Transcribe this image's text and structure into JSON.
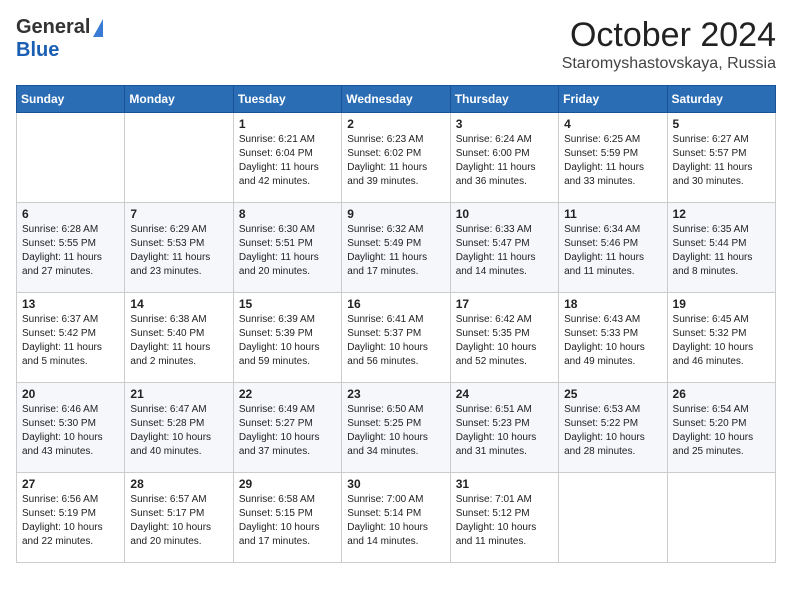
{
  "header": {
    "logo_line1": "General",
    "logo_line2": "Blue",
    "month": "October 2024",
    "location": "Staromyshastovskaya, Russia"
  },
  "days_of_week": [
    "Sunday",
    "Monday",
    "Tuesday",
    "Wednesday",
    "Thursday",
    "Friday",
    "Saturday"
  ],
  "weeks": [
    [
      {
        "day": "",
        "content": ""
      },
      {
        "day": "",
        "content": ""
      },
      {
        "day": "1",
        "content": "Sunrise: 6:21 AM\nSunset: 6:04 PM\nDaylight: 11 hours and 42 minutes."
      },
      {
        "day": "2",
        "content": "Sunrise: 6:23 AM\nSunset: 6:02 PM\nDaylight: 11 hours and 39 minutes."
      },
      {
        "day": "3",
        "content": "Sunrise: 6:24 AM\nSunset: 6:00 PM\nDaylight: 11 hours and 36 minutes."
      },
      {
        "day": "4",
        "content": "Sunrise: 6:25 AM\nSunset: 5:59 PM\nDaylight: 11 hours and 33 minutes."
      },
      {
        "day": "5",
        "content": "Sunrise: 6:27 AM\nSunset: 5:57 PM\nDaylight: 11 hours and 30 minutes."
      }
    ],
    [
      {
        "day": "6",
        "content": "Sunrise: 6:28 AM\nSunset: 5:55 PM\nDaylight: 11 hours and 27 minutes."
      },
      {
        "day": "7",
        "content": "Sunrise: 6:29 AM\nSunset: 5:53 PM\nDaylight: 11 hours and 23 minutes."
      },
      {
        "day": "8",
        "content": "Sunrise: 6:30 AM\nSunset: 5:51 PM\nDaylight: 11 hours and 20 minutes."
      },
      {
        "day": "9",
        "content": "Sunrise: 6:32 AM\nSunset: 5:49 PM\nDaylight: 11 hours and 17 minutes."
      },
      {
        "day": "10",
        "content": "Sunrise: 6:33 AM\nSunset: 5:47 PM\nDaylight: 11 hours and 14 minutes."
      },
      {
        "day": "11",
        "content": "Sunrise: 6:34 AM\nSunset: 5:46 PM\nDaylight: 11 hours and 11 minutes."
      },
      {
        "day": "12",
        "content": "Sunrise: 6:35 AM\nSunset: 5:44 PM\nDaylight: 11 hours and 8 minutes."
      }
    ],
    [
      {
        "day": "13",
        "content": "Sunrise: 6:37 AM\nSunset: 5:42 PM\nDaylight: 11 hours and 5 minutes."
      },
      {
        "day": "14",
        "content": "Sunrise: 6:38 AM\nSunset: 5:40 PM\nDaylight: 11 hours and 2 minutes."
      },
      {
        "day": "15",
        "content": "Sunrise: 6:39 AM\nSunset: 5:39 PM\nDaylight: 10 hours and 59 minutes."
      },
      {
        "day": "16",
        "content": "Sunrise: 6:41 AM\nSunset: 5:37 PM\nDaylight: 10 hours and 56 minutes."
      },
      {
        "day": "17",
        "content": "Sunrise: 6:42 AM\nSunset: 5:35 PM\nDaylight: 10 hours and 52 minutes."
      },
      {
        "day": "18",
        "content": "Sunrise: 6:43 AM\nSunset: 5:33 PM\nDaylight: 10 hours and 49 minutes."
      },
      {
        "day": "19",
        "content": "Sunrise: 6:45 AM\nSunset: 5:32 PM\nDaylight: 10 hours and 46 minutes."
      }
    ],
    [
      {
        "day": "20",
        "content": "Sunrise: 6:46 AM\nSunset: 5:30 PM\nDaylight: 10 hours and 43 minutes."
      },
      {
        "day": "21",
        "content": "Sunrise: 6:47 AM\nSunset: 5:28 PM\nDaylight: 10 hours and 40 minutes."
      },
      {
        "day": "22",
        "content": "Sunrise: 6:49 AM\nSunset: 5:27 PM\nDaylight: 10 hours and 37 minutes."
      },
      {
        "day": "23",
        "content": "Sunrise: 6:50 AM\nSunset: 5:25 PM\nDaylight: 10 hours and 34 minutes."
      },
      {
        "day": "24",
        "content": "Sunrise: 6:51 AM\nSunset: 5:23 PM\nDaylight: 10 hours and 31 minutes."
      },
      {
        "day": "25",
        "content": "Sunrise: 6:53 AM\nSunset: 5:22 PM\nDaylight: 10 hours and 28 minutes."
      },
      {
        "day": "26",
        "content": "Sunrise: 6:54 AM\nSunset: 5:20 PM\nDaylight: 10 hours and 25 minutes."
      }
    ],
    [
      {
        "day": "27",
        "content": "Sunrise: 6:56 AM\nSunset: 5:19 PM\nDaylight: 10 hours and 22 minutes."
      },
      {
        "day": "28",
        "content": "Sunrise: 6:57 AM\nSunset: 5:17 PM\nDaylight: 10 hours and 20 minutes."
      },
      {
        "day": "29",
        "content": "Sunrise: 6:58 AM\nSunset: 5:15 PM\nDaylight: 10 hours and 17 minutes."
      },
      {
        "day": "30",
        "content": "Sunrise: 7:00 AM\nSunset: 5:14 PM\nDaylight: 10 hours and 14 minutes."
      },
      {
        "day": "31",
        "content": "Sunrise: 7:01 AM\nSunset: 5:12 PM\nDaylight: 10 hours and 11 minutes."
      },
      {
        "day": "",
        "content": ""
      },
      {
        "day": "",
        "content": ""
      }
    ]
  ]
}
